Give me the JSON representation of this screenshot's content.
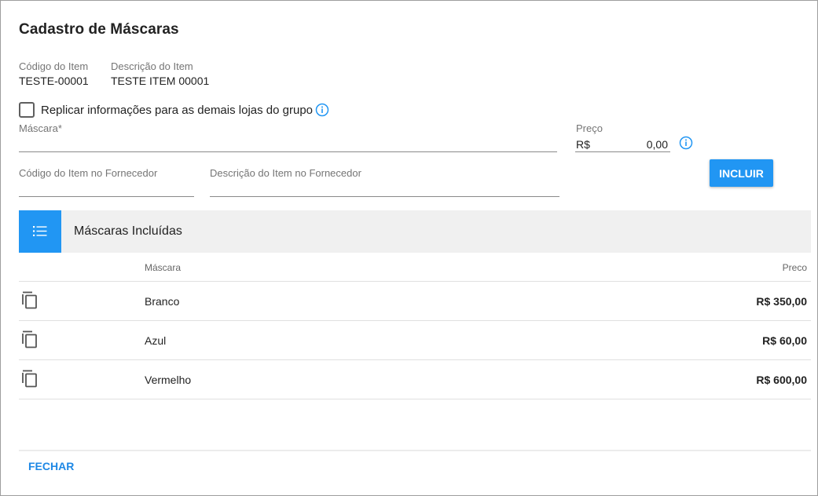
{
  "dialog": {
    "title": "Cadastro de Máscaras"
  },
  "item_info": {
    "code_label": "Código do Item",
    "code_value": "TESTE-00001",
    "desc_label": "Descrição do Item",
    "desc_value": "TESTE ITEM 00001"
  },
  "replicate": {
    "label": "Replicar informações para as demais lojas do grupo",
    "checked": false
  },
  "form": {
    "mask_label": "Máscara*",
    "mask_value": "",
    "price_label": "Preço",
    "currency": "R$",
    "price_value": "0,00",
    "supplier_code_label": "Código do Item no Fornecedor",
    "supplier_code_value": "",
    "supplier_desc_label": "Descrição do Item no Fornecedor",
    "supplier_desc_value": "",
    "include_button": "INCLUIR"
  },
  "included_panel": {
    "title": "Máscaras Incluídas",
    "columns": {
      "mask": "Máscara",
      "price": "Preco"
    },
    "rows": [
      {
        "mask": "Branco",
        "price": "R$ 350,00"
      },
      {
        "mask": "Azul",
        "price": "R$ 60,00"
      },
      {
        "mask": "Vermelho",
        "price": "R$ 600,00"
      }
    ]
  },
  "footer": {
    "close_button": "FECHAR"
  },
  "colors": {
    "accent": "#2196f3",
    "link": "#1e88e5",
    "header_bg": "#f0f0f0"
  },
  "icons": {
    "info": "info-circle-icon",
    "list": "list-icon",
    "copy": "copy-icon"
  }
}
